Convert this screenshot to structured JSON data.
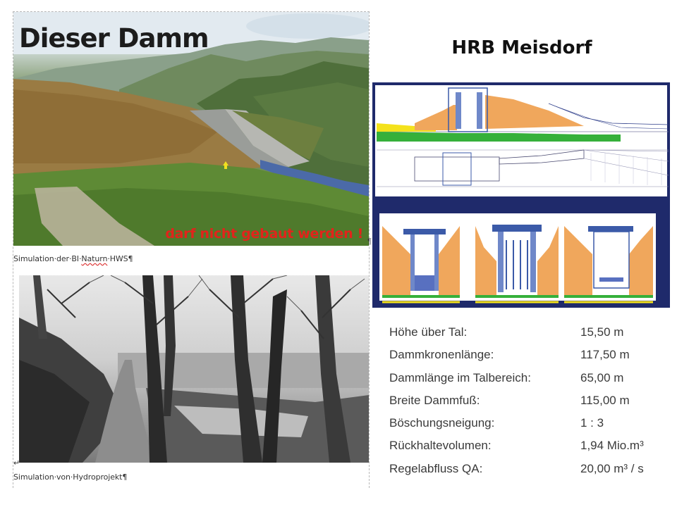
{
  "left_page": {
    "simulation1": {
      "title": "Dieser Damm",
      "slogan": "darf nicht gebaut werden !"
    },
    "pilcrow": "¶",
    "caption1": {
      "before": "Simulation·der·BI·",
      "marked": "Naturn",
      "after": "·HWS¶"
    },
    "return_mark": "↵",
    "caption2": "Simulation·von·Hydroprojekt¶"
  },
  "right": {
    "title": "HRB Meisdorf",
    "specs": [
      {
        "label": "Höhe über Tal:",
        "value": "15,50 m"
      },
      {
        "label": "Dammkronenlänge:",
        "value": "117,50 m"
      },
      {
        "label": "Dammlänge im Talbereich:",
        "value": "65,00 m"
      },
      {
        "label": "Breite Dammfuß:",
        "value": "115,00 m"
      },
      {
        "label": "Böschungsneigung:",
        "value": "1 : 3"
      },
      {
        "label": "Rückhaltevolumen:",
        "value": "1,94 Mio.m³"
      },
      {
        "label": "Regelabfluss QA:",
        "value": "20,00 m³ / s"
      }
    ]
  },
  "colors": {
    "slogan": "#e1241b",
    "drawing_frame": "#1f2a6b",
    "embankment_fill": "#f0a75c"
  }
}
